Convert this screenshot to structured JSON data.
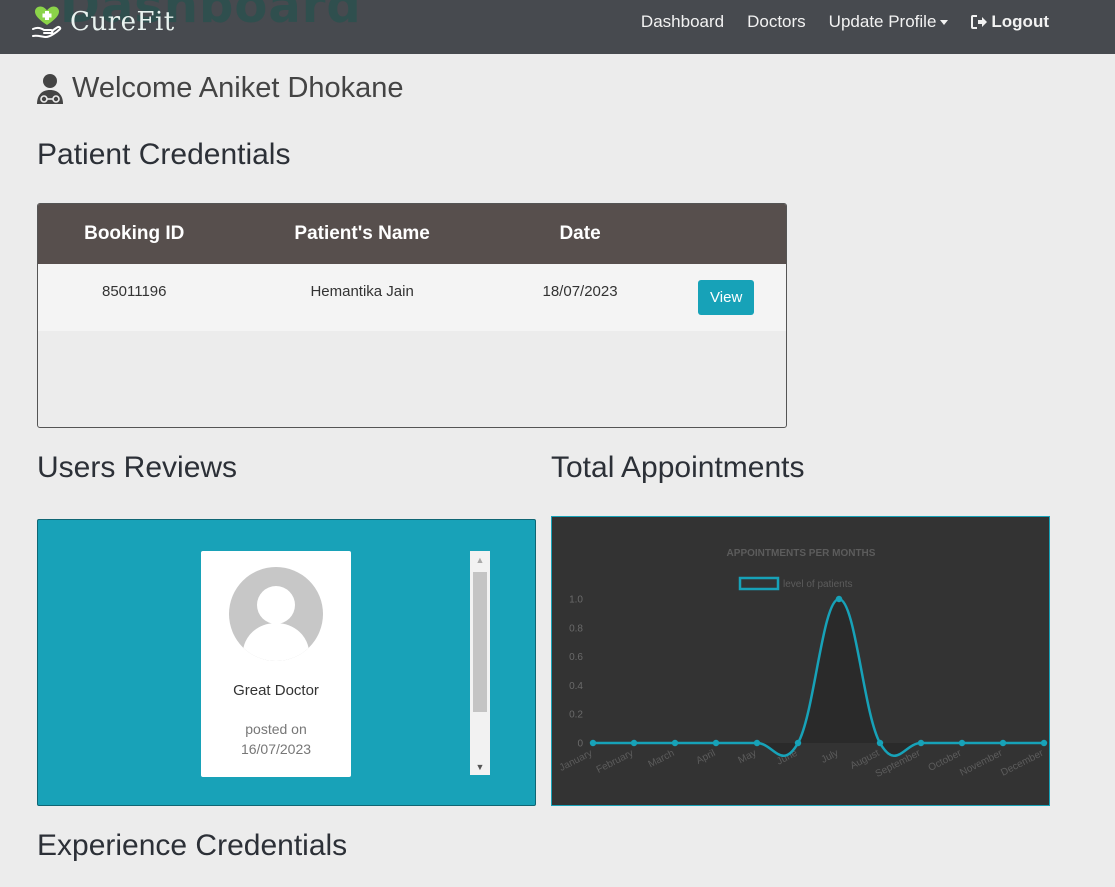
{
  "navbar": {
    "ghost_title": "Dashboard",
    "brand": "CureFit",
    "links": {
      "dashboard": "Dashboard",
      "doctors": "Doctors",
      "update_profile": "Update Profile",
      "logout": "Logout"
    }
  },
  "welcome": {
    "text": "Welcome Aniket Dhokane"
  },
  "patient_credentials": {
    "title": "Patient Credentials",
    "headers": {
      "booking_id": "Booking ID",
      "name": "Patient's Name",
      "date": "Date"
    },
    "rows": [
      {
        "booking_id": "85011196",
        "name": "Hemantika Jain",
        "date": "18/07/2023",
        "action": "View"
      }
    ]
  },
  "reviews": {
    "title": "Users Reviews",
    "items": [
      {
        "text": "Great Doctor",
        "posted_label": "posted on",
        "posted_date": "16/07/2023"
      }
    ]
  },
  "appointments": {
    "title": "Total Appointments"
  },
  "experience": {
    "title": "Experience Credentials"
  },
  "colors": {
    "accent": "#17a2b8",
    "navbar": "#474a4f",
    "table_head": "#574f4d",
    "chart_bg": "#333333"
  },
  "chart_data": {
    "type": "line",
    "title": "APPOINTMENTS PER MONTHS",
    "legend": "level of patients",
    "legend_position": "top",
    "categories": [
      "January",
      "February",
      "March",
      "April",
      "May",
      "June",
      "July",
      "August",
      "September",
      "October",
      "November",
      "December"
    ],
    "series": [
      {
        "name": "level of patients",
        "values": [
          0,
          0,
          0,
          0,
          0,
          0,
          1,
          0,
          0,
          0,
          0,
          0
        ]
      }
    ],
    "yticks": [
      "0",
      "0.2",
      "0.4",
      "0.6",
      "0.8",
      "1.0"
    ],
    "ylim": [
      0,
      1
    ],
    "grid": false
  }
}
